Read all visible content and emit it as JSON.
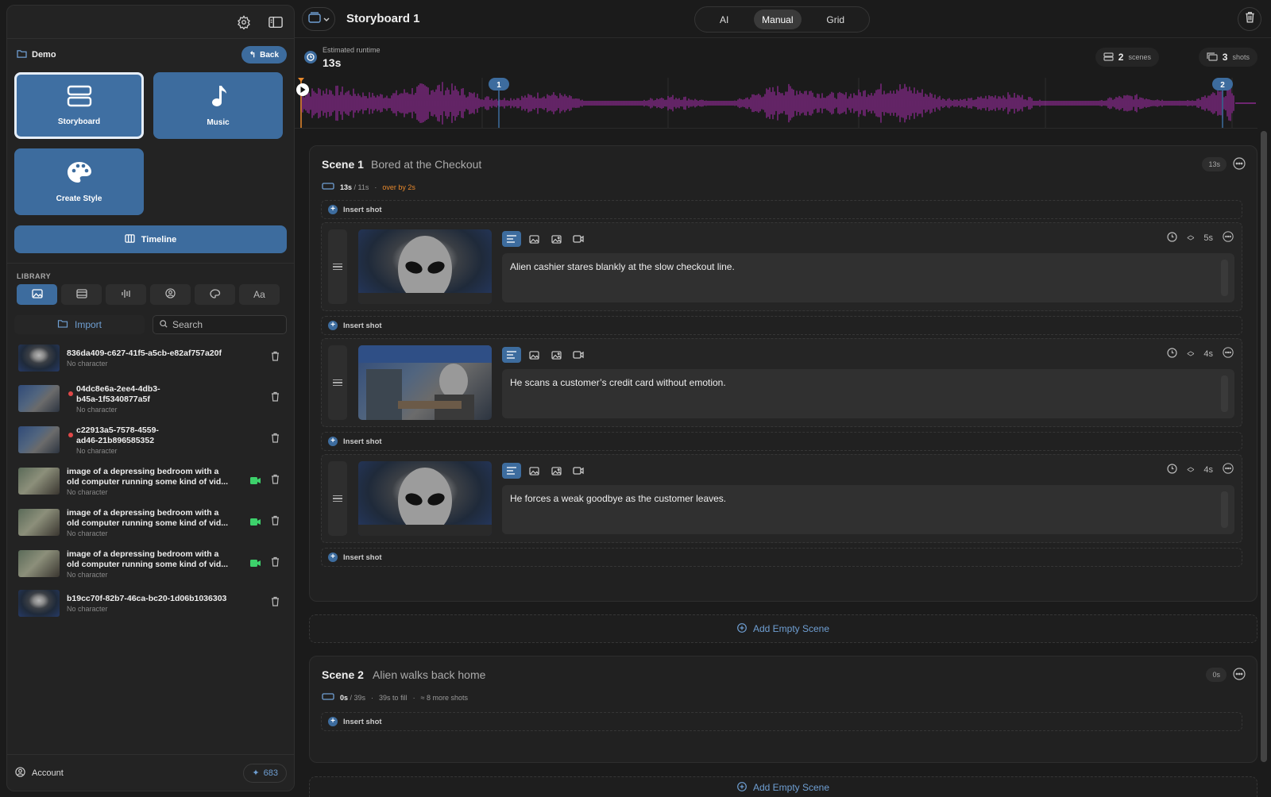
{
  "sidebar": {
    "project": "Demo",
    "back_label": "Back",
    "tiles": [
      {
        "label": "Storyboard",
        "icon": "storyboard-icon"
      },
      {
        "label": "Music",
        "icon": "music-note-icon"
      },
      {
        "label": "Create Style",
        "icon": "palette-icon"
      }
    ],
    "timeline_label": "Timeline",
    "library_title": "LIBRARY",
    "library_tabs": [
      "image",
      "film",
      "audio",
      "character",
      "style",
      "Aa"
    ],
    "import_label": "Import",
    "search_placeholder": "Search",
    "items": [
      {
        "name": "836da409-c627-41f5-a5cb-e82af757a20f",
        "name2": "",
        "sub": "No character",
        "dot": false,
        "video": false
      },
      {
        "name": "04dc8e6a-2ee4-4db3-",
        "name2": "b45a-1f5340877a5f",
        "sub": "No character",
        "dot": true,
        "video": false
      },
      {
        "name": "c22913a5-7578-4559-",
        "name2": "ad46-21b896585352",
        "sub": "No character",
        "dot": true,
        "video": false
      },
      {
        "name": "image of a depressing bedroom with a",
        "name2": "old computer running some kind of vid...",
        "sub": "No character",
        "dot": false,
        "video": true
      },
      {
        "name": "image of a depressing bedroom with a",
        "name2": "old computer running some kind of vid...",
        "sub": "No character",
        "dot": false,
        "video": true
      },
      {
        "name": "image of a depressing bedroom with a",
        "name2": "old computer running some kind of vid...",
        "sub": "No character",
        "dot": false,
        "video": true
      },
      {
        "name": "b19cc70f-82b7-46ca-bc20-1d06b1036303",
        "name2": "",
        "sub": "No character",
        "dot": false,
        "video": false
      }
    ],
    "account_label": "Account",
    "credits": "683"
  },
  "topbar": {
    "title": "Storyboard 1",
    "modes": [
      "AI",
      "Manual",
      "Grid"
    ],
    "active_mode": "Manual"
  },
  "runtime": {
    "label": "Estimated runtime",
    "value": "13s",
    "scenes_count": "2",
    "scenes_label": "scenes",
    "shots_count": "3",
    "shots_label": "shots"
  },
  "waveform": {
    "color": "#8a2a8e",
    "markers": [
      "1",
      "2"
    ]
  },
  "scenes": [
    {
      "title": "Scene 1",
      "name": "Bored at the Checkout",
      "duration_badge": "13s",
      "meta_used": "13s",
      "meta_total": "/ 11s",
      "meta_note": "over by 2s",
      "shots": [
        {
          "duration": "5s",
          "prompt": "Alien cashier stares blankly at the slow checkout line."
        },
        {
          "duration": "4s",
          "prompt": "He scans a customer’s credit card without emotion."
        },
        {
          "duration": "4s",
          "prompt": "He forces a weak goodbye as the customer leaves."
        }
      ]
    },
    {
      "title": "Scene 2",
      "name": "Alien walks back home",
      "duration_badge": "0s",
      "meta_used": "0s",
      "meta_total": "/ 39s",
      "meta_fill": "39s to fill",
      "meta_more": "≈ 8 more shots"
    }
  ],
  "insert_shot_label": "Insert shot",
  "add_empty_scene_label": "Add Empty Scene",
  "colors": {
    "accent": "#3d6c9e",
    "accent_text": "#6f9fd3",
    "warning": "#e8892c",
    "video_badge": "#3dd16b",
    "status_dot": "#e04848"
  }
}
